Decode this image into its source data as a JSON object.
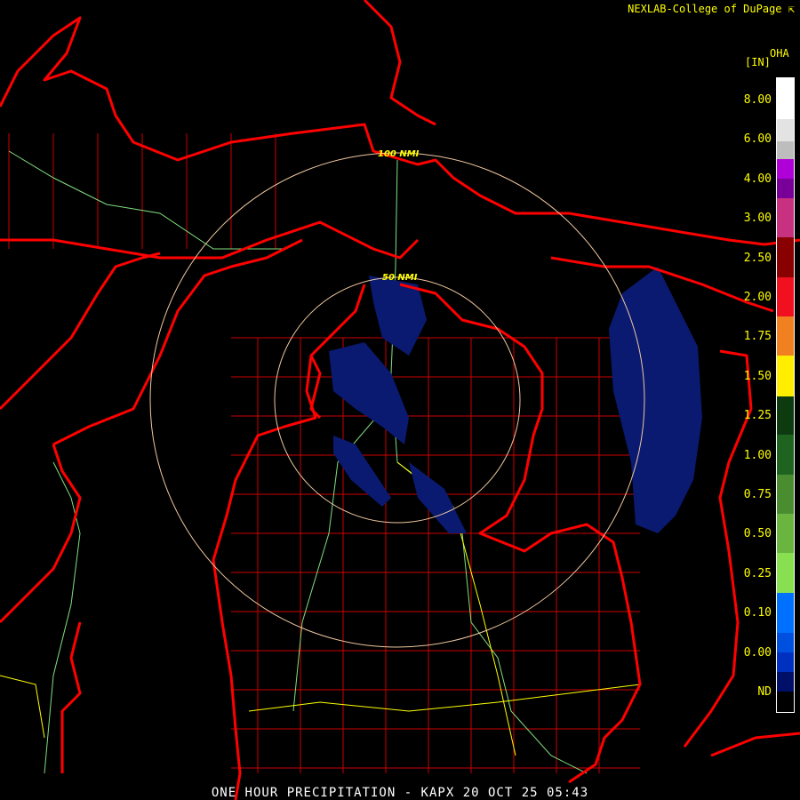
{
  "credit": "NEXLAB-College of DuPage",
  "credit_icon": "external-link-icon",
  "product_code": "OHA",
  "unit": "[IN]",
  "footer": "ONE HOUR PRECIPITATION - KAPX 20 OCT 25 05:43",
  "range_rings": [
    "50 NMI",
    "100 NMI"
  ],
  "legend": {
    "labels": [
      "8.00",
      "6.00",
      "4.00",
      "3.00",
      "2.50",
      "2.00",
      "1.75",
      "1.50",
      "1.25",
      "1.00",
      "0.75",
      "0.50",
      "0.25",
      "0.10",
      "0.00",
      "ND"
    ],
    "colors": [
      "#ffffff",
      "#e3e3e3",
      "#bdbdbd",
      "#b000d8",
      "#780098",
      "#c83080",
      "#880000",
      "#f01020",
      "#f08020",
      "#ffee00",
      "#0e3a10",
      "#1e6420",
      "#4a8c30",
      "#6ab440",
      "#88e050",
      "#0070ff",
      "#0050e0",
      "#0030c0",
      "#001068",
      "#000000"
    ]
  },
  "colors": {
    "borders": "#ff0000",
    "counties": "#cc0000",
    "highways": "#ffff00",
    "roads": "#80e080",
    "rings": "#f0c8a0",
    "precip": "#0a1a70"
  }
}
